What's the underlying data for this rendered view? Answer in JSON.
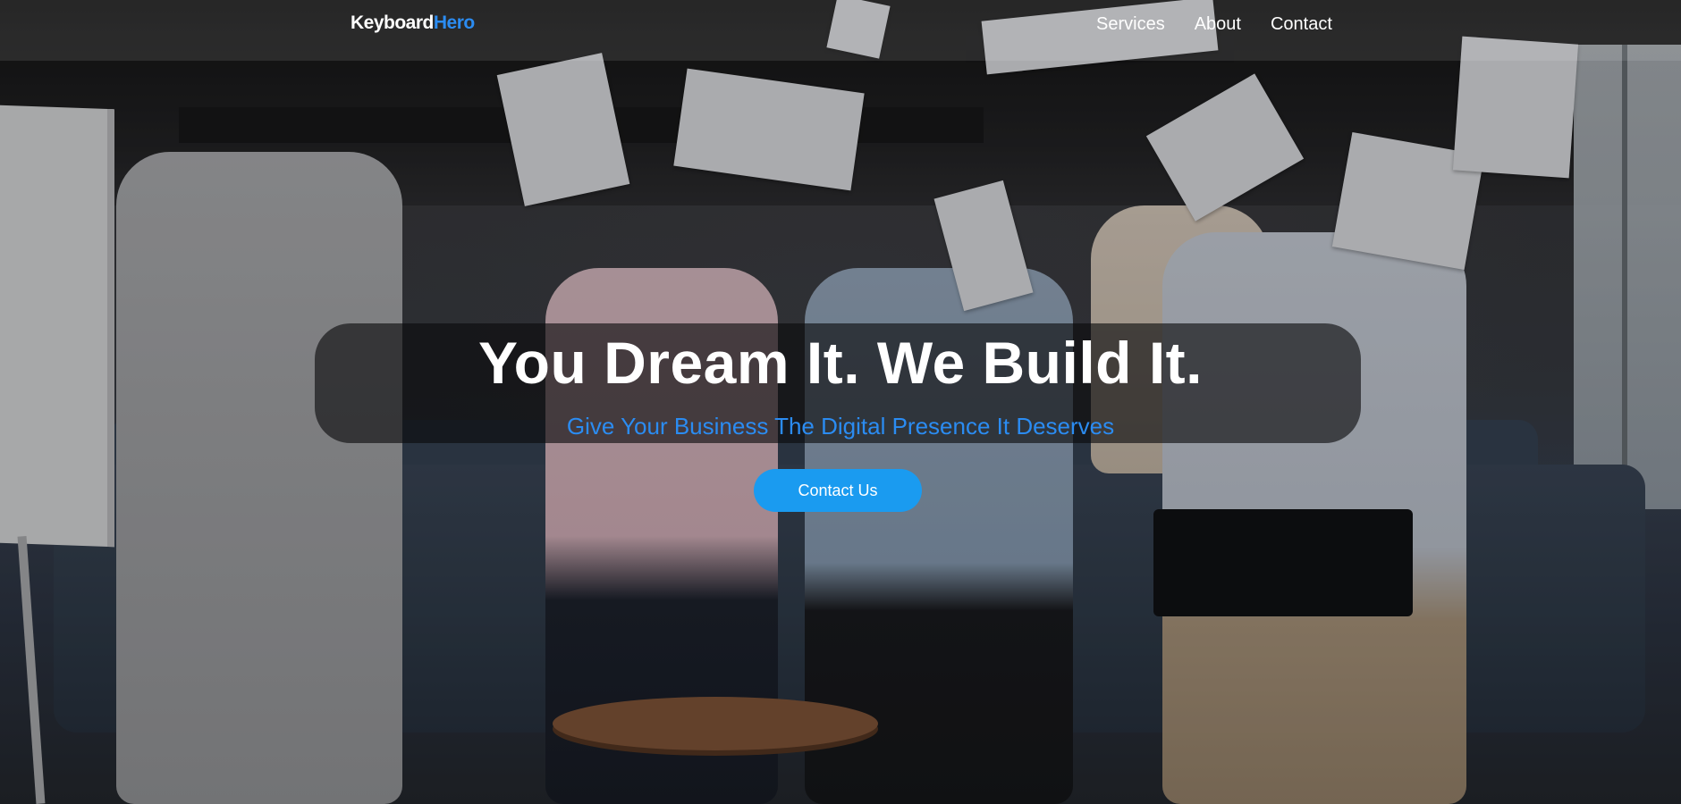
{
  "header": {
    "logo": {
      "primary": "Keyboard",
      "accent": "Hero"
    },
    "nav": [
      {
        "label": "Services"
      },
      {
        "label": "About"
      },
      {
        "label": "Contact"
      }
    ]
  },
  "hero": {
    "headline": "You Dream It. We Build It.",
    "subheadline": "Give Your Business The Digital Presence It Deserves",
    "cta_label": "Contact Us",
    "background_image": "team-celebrating-throwing-papers"
  },
  "colors": {
    "accent": "#2b8cf2",
    "button": "#1a9bf0",
    "text_on_dark": "#ffffff"
  }
}
